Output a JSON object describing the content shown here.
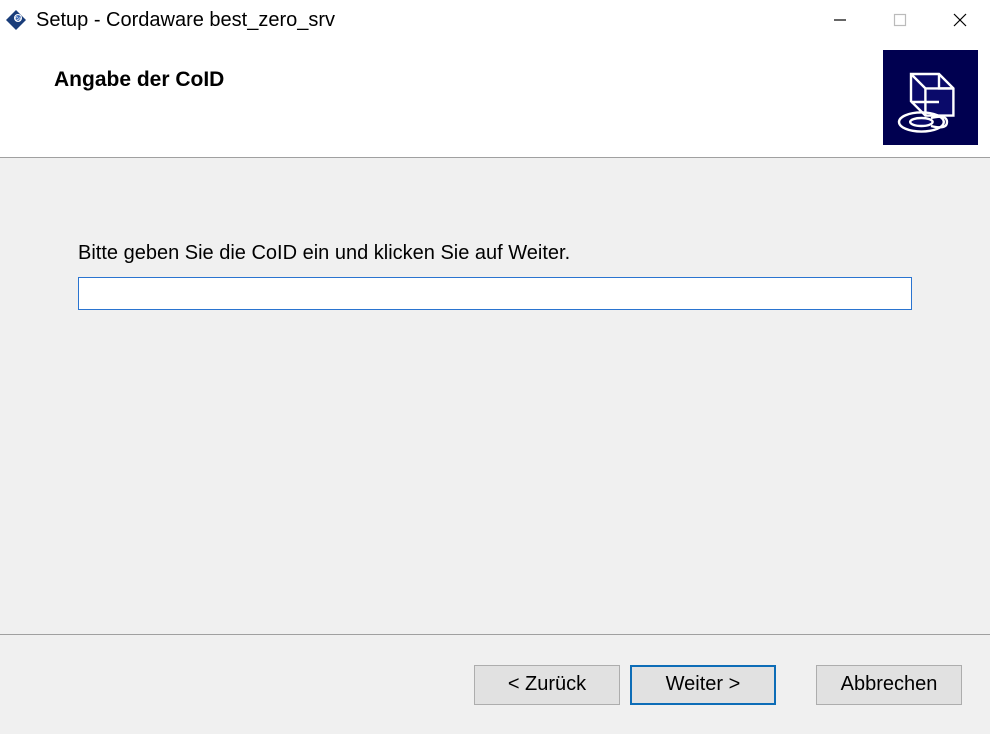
{
  "window": {
    "title": "Setup - Cordaware best_zero_srv"
  },
  "header": {
    "heading": "Angabe der CoID"
  },
  "content": {
    "instruction": "Bitte geben Sie die CoID ein und klicken Sie auf Weiter.",
    "input_value": ""
  },
  "footer": {
    "back_label": "< Zurück",
    "next_label": "Weiter >",
    "cancel_label": "Abbrechen"
  }
}
